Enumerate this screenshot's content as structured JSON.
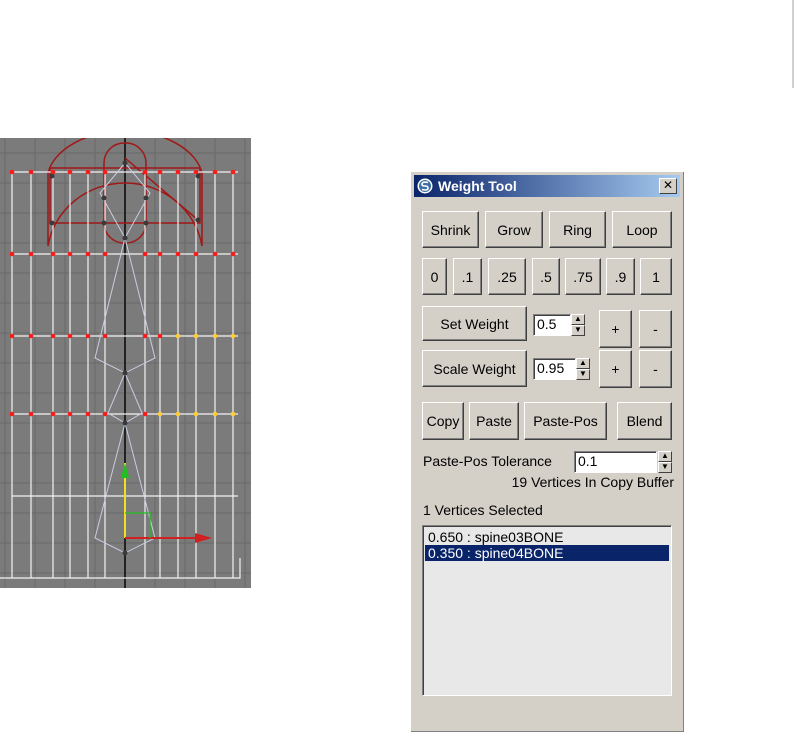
{
  "window": {
    "title": "Weight Tool",
    "close_glyph": "✕"
  },
  "ring_buttons": {
    "shrink": "Shrink",
    "grow": "Grow",
    "ring": "Ring",
    "loop": "Loop"
  },
  "presets": [
    "0",
    ".1",
    ".25",
    ".5",
    ".75",
    ".9",
    "1"
  ],
  "set_weight": {
    "label": "Set Weight",
    "value": "0.5",
    "plus": "+",
    "minus": "-"
  },
  "scale_weight": {
    "label": "Scale Weight",
    "value": "0.95",
    "plus": "+",
    "minus": "-"
  },
  "clipboard": {
    "copy": "Copy",
    "paste": "Paste",
    "paste_pos": "Paste-Pos",
    "blend": "Blend"
  },
  "paste_pos_tolerance": {
    "label": "Paste-Pos Tolerance",
    "value": "0.1"
  },
  "copy_buffer_status": "19 Vertices In Copy Buffer",
  "selection_status": "1 Vertices Selected",
  "bone_weights": [
    {
      "text": "0.650 : spine03BONE",
      "selected": false
    },
    {
      "text": "0.350 : spine04BONE",
      "selected": true
    }
  ],
  "spinner_glyphs": {
    "up": "▲",
    "down": "▼"
  },
  "icons": {
    "app": "3dsmax-logo-icon",
    "close": "close-icon"
  },
  "colors": {
    "title_start": "#0a246a",
    "title_end": "#a6caf0",
    "selection": "#0a246a",
    "viewport_bg": "#7b7b7b",
    "vertex_red": "#ff0000",
    "vertex_yellow": "#ffcc33"
  }
}
